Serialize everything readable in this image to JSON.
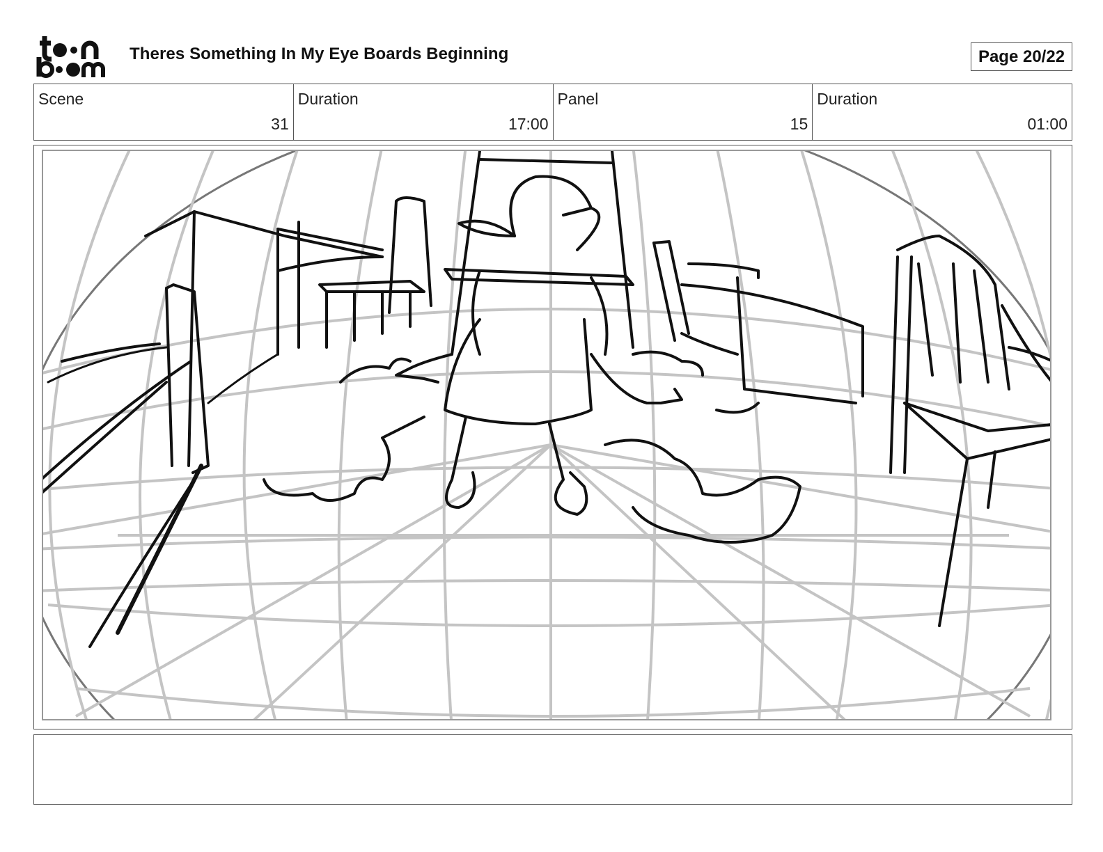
{
  "header": {
    "logo_text_top": "toon",
    "logo_text_bottom": "boom",
    "title": "Theres Something In My Eye Boards Beginning",
    "page": "Page 20/22"
  },
  "info": {
    "scene_label": "Scene",
    "scene_value": "31",
    "scene_duration_label": "Duration",
    "scene_duration_value": "17:00",
    "panel_label": "Panel",
    "panel_value": "15",
    "panel_duration_label": "Duration",
    "panel_duration_value": "01:00"
  },
  "panel": {
    "description": "",
    "colors": {
      "guide": "#c4c4c4",
      "ink": "#111111"
    }
  },
  "notes": {
    "text": ""
  }
}
